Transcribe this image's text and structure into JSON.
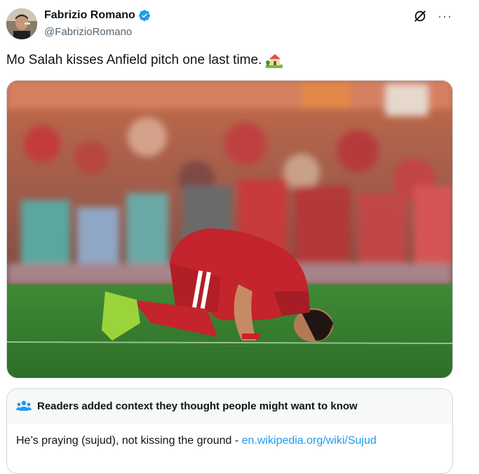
{
  "author": {
    "display_name": "Fabrizio Romano",
    "handle": "@FabrizioRomano",
    "verified_icon": "verified-badge-icon",
    "avatar_icon": "profile-avatar"
  },
  "header_actions": {
    "grok_icon": "grok-icon",
    "more_icon": "more-options-icon",
    "more_label": "···"
  },
  "tweet": {
    "text": "Mo Salah kisses Anfield pitch one last time.",
    "emoji_icon": "house-with-garden-emoji"
  },
  "media": {
    "kind": "photo",
    "icon": "match-photo"
  },
  "community_note": {
    "title": "Readers added context they thought people might want to know",
    "body_text": "He’s praying (sujud), not kissing the ground - ",
    "link_text": "en.wikipedia.org/wiki/Sujud",
    "icon": "people-icon"
  },
  "colors": {
    "brand_blue": "#1d9bf0",
    "text_primary": "#0f1419",
    "text_secondary": "#536471",
    "border": "#cfd9de",
    "note_header_bg": "#f7f9f9"
  }
}
